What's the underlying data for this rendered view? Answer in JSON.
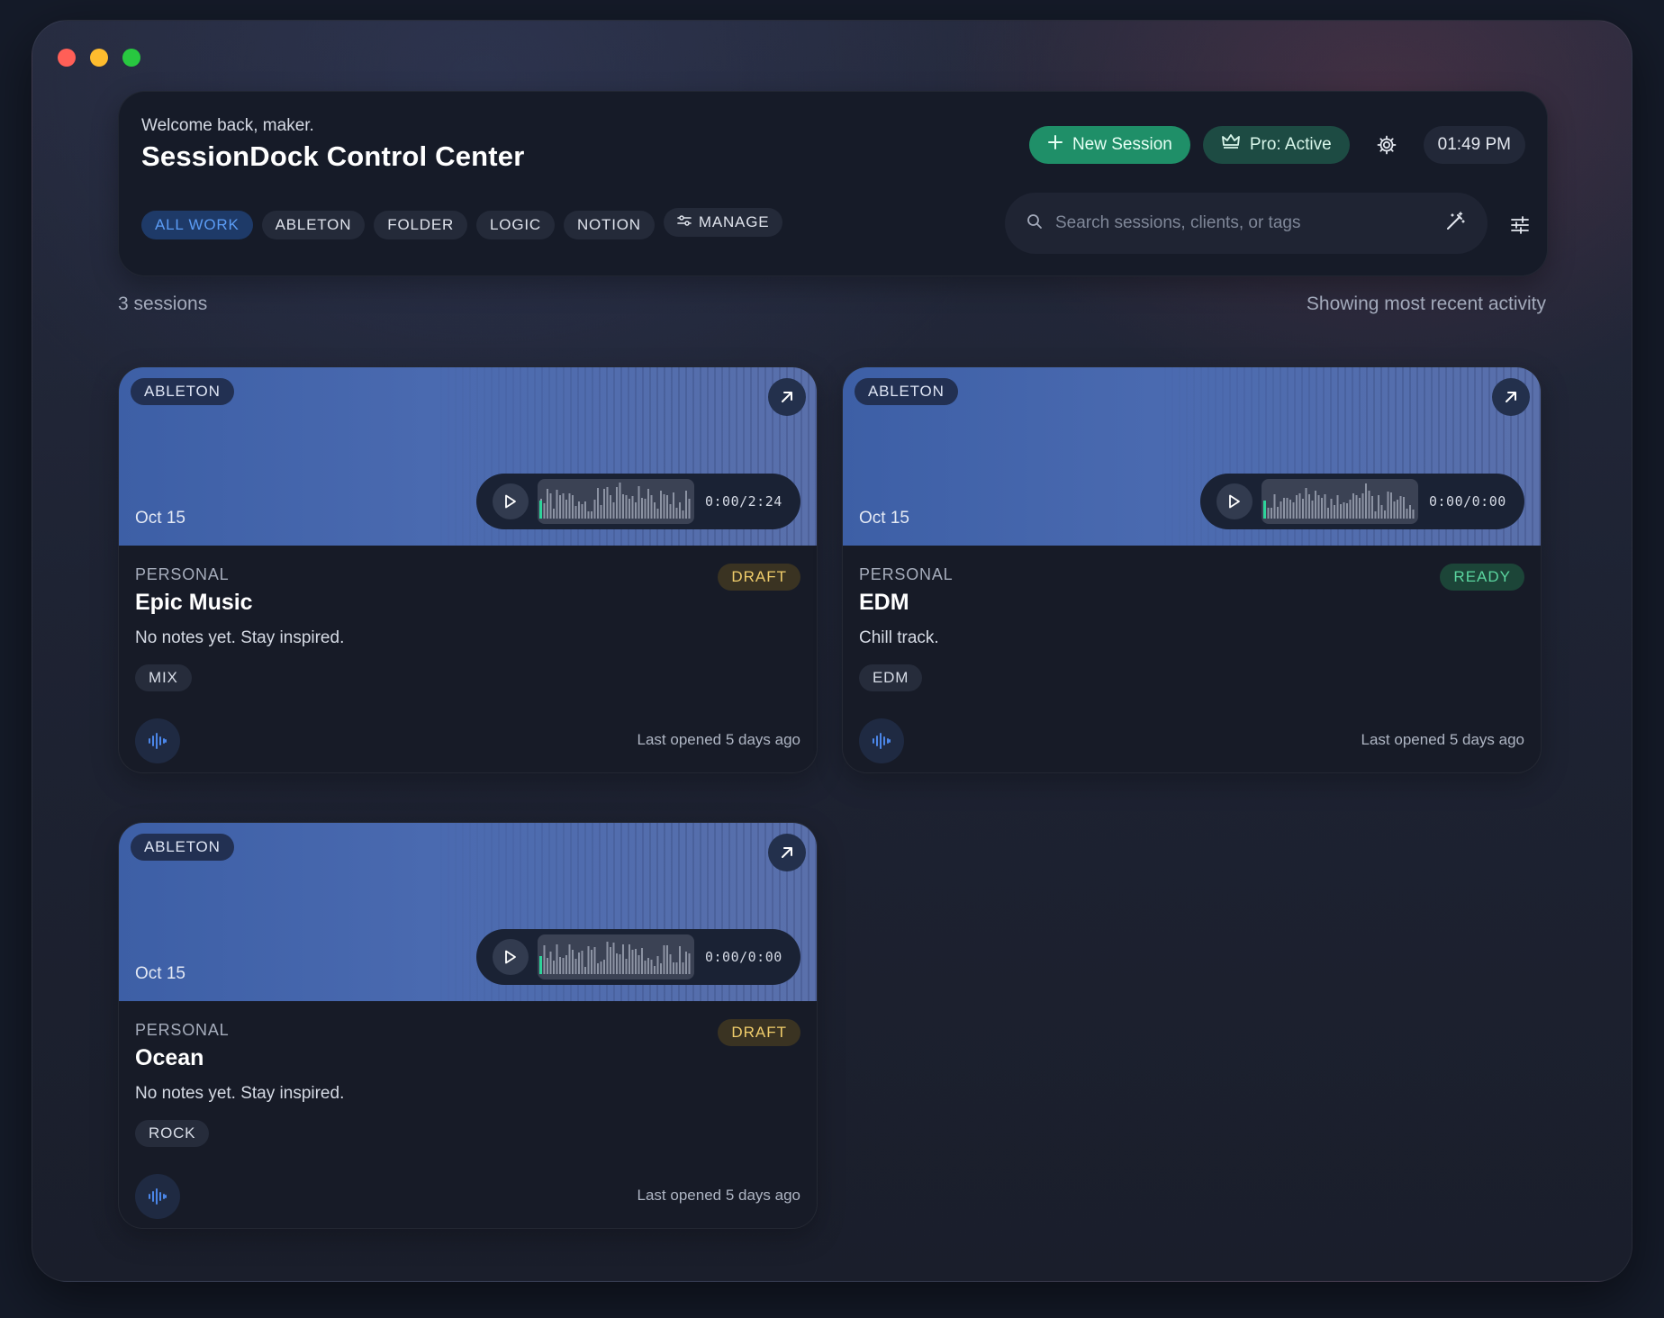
{
  "header": {
    "welcome": "Welcome back, maker.",
    "title": "SessionDock Control Center",
    "new_session_label": "New Session",
    "pro_label": "Pro: Active",
    "time": "01:49 PM"
  },
  "filters": [
    {
      "label": "ALL WORK",
      "active": true
    },
    {
      "label": "ABLETON",
      "active": false
    },
    {
      "label": "FOLDER",
      "active": false
    },
    {
      "label": "LOGIC",
      "active": false
    },
    {
      "label": "NOTION",
      "active": false
    },
    {
      "label": "MANAGE",
      "active": false
    }
  ],
  "search": {
    "placeholder": "Search sessions, clients, or tags"
  },
  "summary": {
    "count": "3 sessions",
    "sort_note": "Showing most recent activity"
  },
  "colors": {
    "accent_green": "#1f8f68",
    "active_filter": "#5b9cf5",
    "draft": "#f0cd6b",
    "ready": "#5bd6a0",
    "waveform_progress": "#2ed39a"
  },
  "sessions": [
    {
      "daw": "ABLETON",
      "date": "Oct 15",
      "time": "0:00/2:24",
      "client": "PERSONAL",
      "name": "Epic Music",
      "status": "DRAFT",
      "notes": "No notes yet. Stay inspired.",
      "tag": "MIX",
      "last_opened": "Last opened 5 days ago"
    },
    {
      "daw": "ABLETON",
      "date": "Oct 15",
      "time": "0:00/0:00",
      "client": "PERSONAL",
      "name": "EDM",
      "status": "READY",
      "notes": "Chill track.",
      "tag": "EDM",
      "last_opened": "Last opened 5 days ago"
    },
    {
      "daw": "ABLETON",
      "date": "Oct 15",
      "time": "0:00/0:00",
      "client": "PERSONAL",
      "name": "Ocean",
      "status": "DRAFT",
      "notes": "No notes yet. Stay inspired.",
      "tag": "ROCK",
      "last_opened": "Last opened 5 days ago"
    }
  ]
}
